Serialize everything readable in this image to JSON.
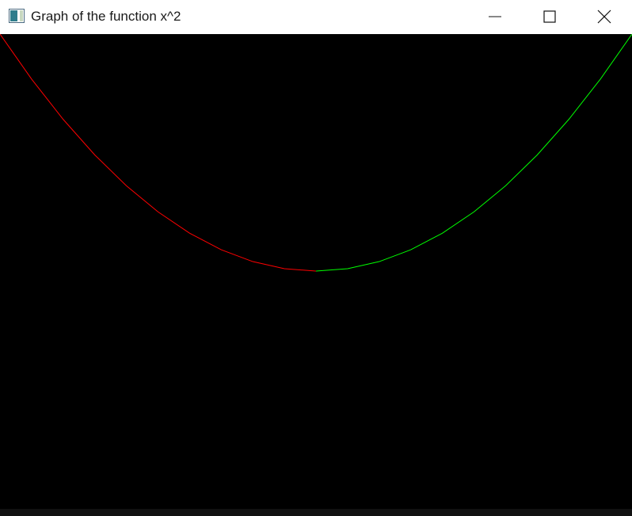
{
  "window": {
    "title": "Graph of the function x^2",
    "controls": {
      "minimize_icon": "minimize-icon",
      "maximize_icon": "maximize-icon",
      "close_icon": "close-icon"
    }
  },
  "colors": {
    "background": "#000000",
    "negative_branch": "#ff0000",
    "positive_branch": "#00ff00"
  },
  "chart_data": {
    "type": "line",
    "function": "x^2",
    "series": [
      {
        "x": [
          -10,
          -9,
          -8,
          -7,
          -6,
          -5,
          -4,
          -3,
          -2,
          -1,
          0
        ],
        "y": [
          100,
          81,
          64,
          49,
          36,
          25,
          16,
          9,
          4,
          1,
          0
        ],
        "color": "#ff0000"
      },
      {
        "x": [
          0,
          1,
          2,
          3,
          4,
          5,
          6,
          7,
          8,
          9,
          10
        ],
        "y": [
          0,
          1,
          4,
          9,
          16,
          25,
          36,
          49,
          64,
          81,
          100
        ],
        "color": "#00ff00"
      }
    ]
  }
}
